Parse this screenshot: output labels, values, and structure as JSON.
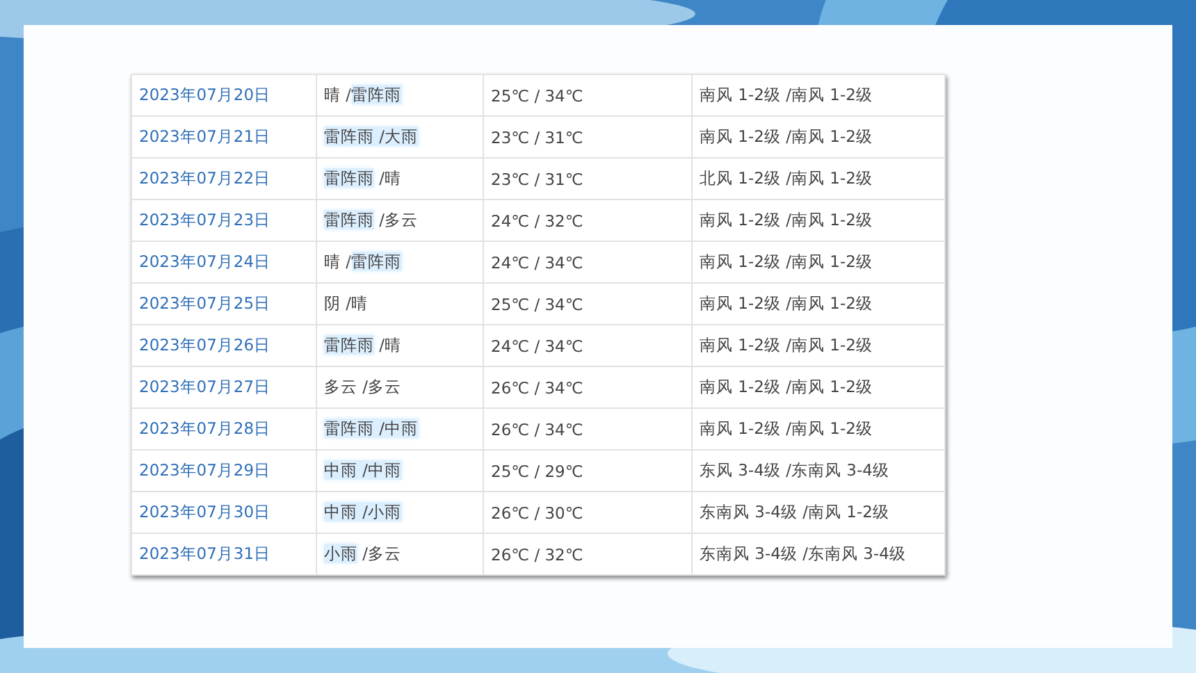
{
  "table": {
    "rows": [
      {
        "date": "2023年07月20日",
        "weather": [
          {
            "text": "晴 /",
            "highlighted": false
          },
          {
            "text": "雷阵雨",
            "highlighted": true
          }
        ],
        "temperature": "25℃ / 34℃",
        "wind": "南风 1-2级 /南风 1-2级"
      },
      {
        "date": "2023年07月21日",
        "weather": [
          {
            "text": "雷阵雨 /大雨",
            "highlighted": true
          }
        ],
        "temperature": "23℃ / 31℃",
        "wind": "南风 1-2级 /南风 1-2级"
      },
      {
        "date": "2023年07月22日",
        "weather": [
          {
            "text": "雷阵雨",
            "highlighted": true
          },
          {
            "text": " /晴",
            "highlighted": false
          }
        ],
        "temperature": "23℃ / 31℃",
        "wind": "北风 1-2级 /南风 1-2级"
      },
      {
        "date": "2023年07月23日",
        "weather": [
          {
            "text": "雷阵雨",
            "highlighted": true
          },
          {
            "text": " /多云",
            "highlighted": false
          }
        ],
        "temperature": "24℃ / 32℃",
        "wind": "南风 1-2级 /南风 1-2级"
      },
      {
        "date": "2023年07月24日",
        "weather": [
          {
            "text": "晴 /",
            "highlighted": false
          },
          {
            "text": "雷阵雨",
            "highlighted": true
          }
        ],
        "temperature": "24℃ / 34℃",
        "wind": "南风 1-2级 /南风 1-2级"
      },
      {
        "date": "2023年07月25日",
        "weather": [
          {
            "text": "阴 /晴",
            "highlighted": false
          }
        ],
        "temperature": "25℃ / 34℃",
        "wind": "南风 1-2级 /南风 1-2级"
      },
      {
        "date": "2023年07月26日",
        "weather": [
          {
            "text": "雷阵雨",
            "highlighted": true
          },
          {
            "text": " /晴",
            "highlighted": false
          }
        ],
        "temperature": "24℃ / 34℃",
        "wind": "南风 1-2级 /南风 1-2级"
      },
      {
        "date": "2023年07月27日",
        "weather": [
          {
            "text": "多云 /多云",
            "highlighted": false
          }
        ],
        "temperature": "26℃ / 34℃",
        "wind": "南风 1-2级 /南风 1-2级"
      },
      {
        "date": "2023年07月28日",
        "weather": [
          {
            "text": "雷阵雨 /中雨",
            "highlighted": true
          }
        ],
        "temperature": "26℃ / 34℃",
        "wind": "南风 1-2级 /南风 1-2级"
      },
      {
        "date": "2023年07月29日",
        "weather": [
          {
            "text": "中雨 /中雨",
            "highlighted": true
          }
        ],
        "temperature": "25℃ / 29℃",
        "wind": "东风 3-4级 /东南风 3-4级"
      },
      {
        "date": "2023年07月30日",
        "weather": [
          {
            "text": "中雨 /小雨",
            "highlighted": true
          }
        ],
        "temperature": "26℃ / 30℃",
        "wind": "东南风 3-4级 /南风 1-2级"
      },
      {
        "date": "2023年07月31日",
        "weather": [
          {
            "text": "小雨",
            "highlighted": true
          },
          {
            "text": " /多云",
            "highlighted": false
          }
        ],
        "temperature": "26℃ / 32℃",
        "wind": "东南风 3-4级 /东南风 3-4级"
      }
    ]
  }
}
